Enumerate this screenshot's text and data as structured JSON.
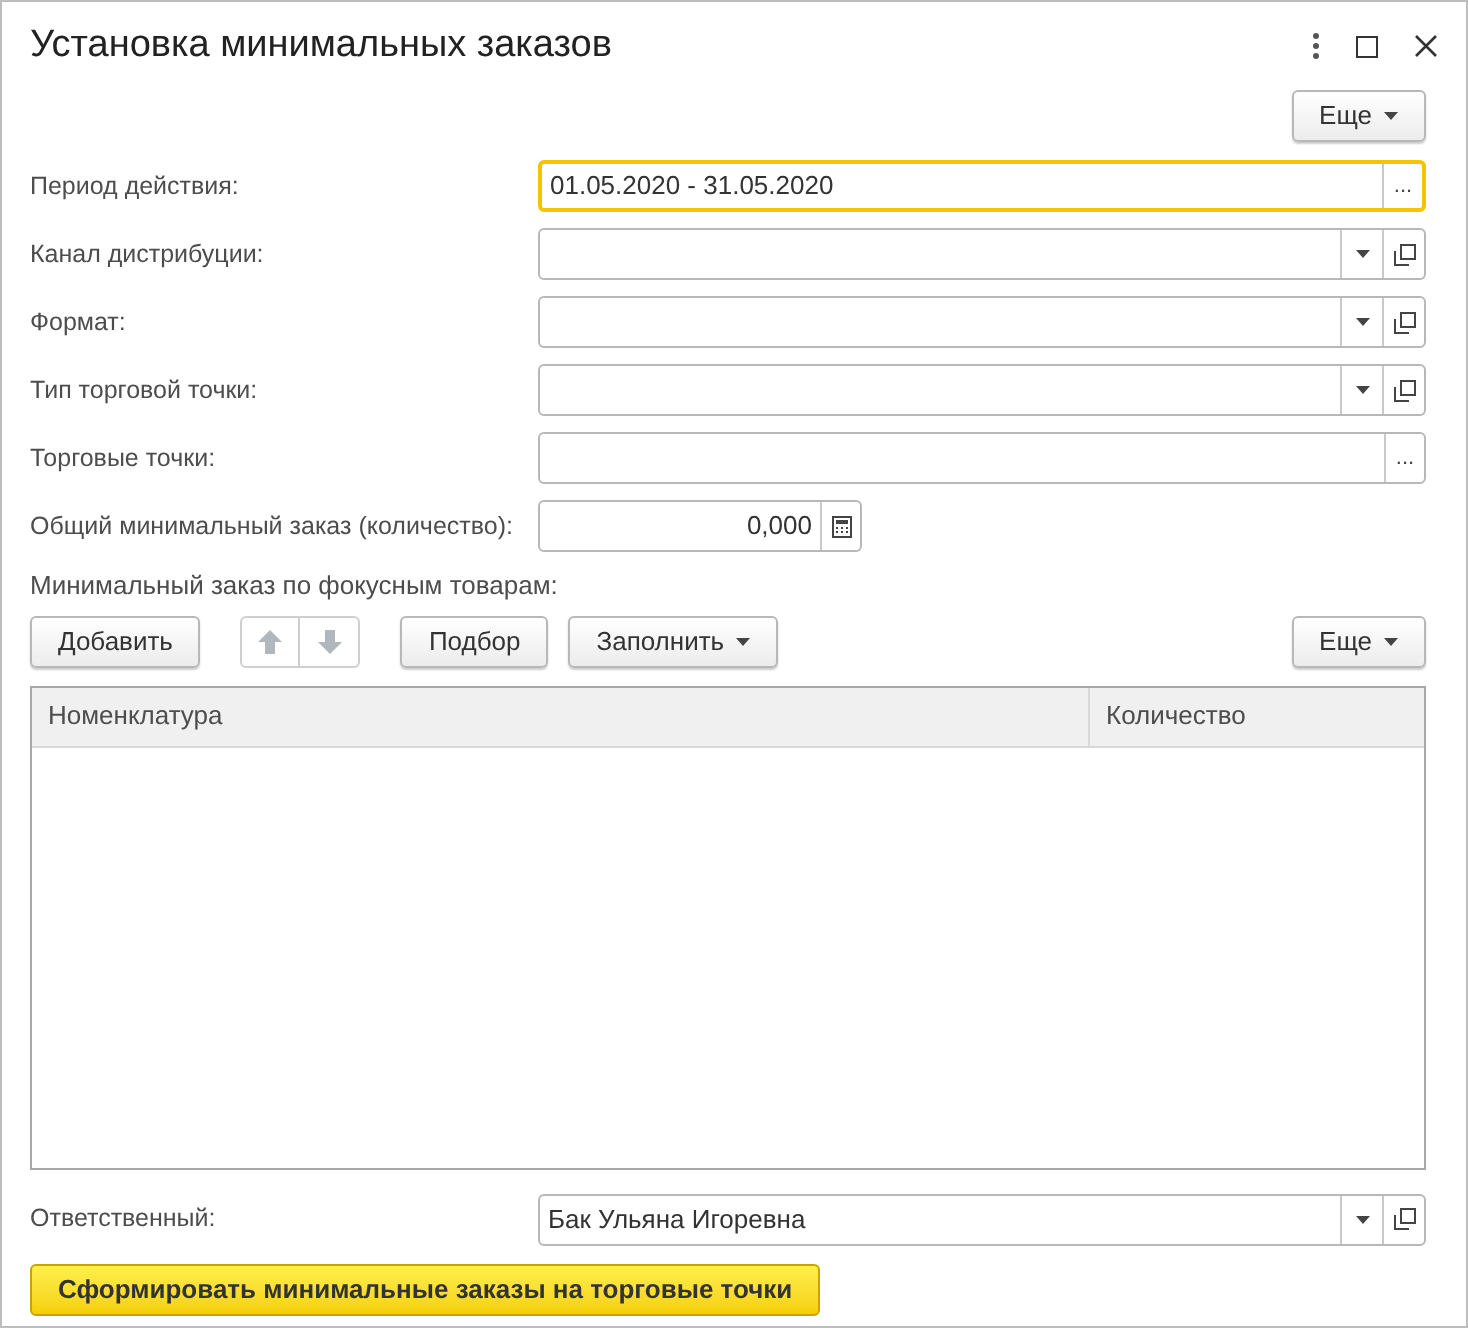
{
  "window": {
    "title": "Установка минимальных заказов"
  },
  "top_more_button": "Еще",
  "fields": [
    {
      "label": "Период действия:",
      "kind": "period",
      "value": "01.05.2020 - 31.05.2020",
      "focused": true,
      "button_text": "..."
    },
    {
      "label": "Канал дистрибуции:",
      "kind": "combo",
      "focused": false
    },
    {
      "label": "Формат:",
      "kind": "combo",
      "focused": false
    },
    {
      "label": "Тип торговой точки:",
      "kind": "combo",
      "focused": false
    },
    {
      "label": "Торговые точки:",
      "kind": "period",
      "focused": false,
      "button_text": "..."
    },
    {
      "label": "Общий минимальный заказ (количество):",
      "kind": "number",
      "value": "0,000",
      "focused": false
    }
  ],
  "table_section": {
    "title": "Минимальный заказ по фокусным товарам:",
    "add_button": "Добавить",
    "move_buttons_disabled": true,
    "pick_button": "Подбор",
    "fill_button": "Заполнить",
    "more_button": "Еще",
    "columns": [
      "Номенклатура",
      "Количество"
    ]
  },
  "responsible": {
    "label": "Ответственный:",
    "value": "Бак Ульяна Игоревна"
  },
  "submit_button": "Сформировать минимальные заказы на торговые точки"
}
